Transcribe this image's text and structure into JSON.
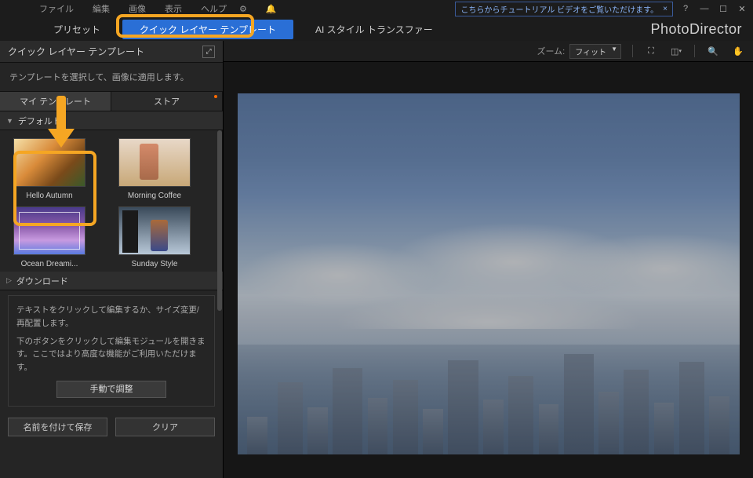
{
  "menu": {
    "file": "ファイル",
    "edit": "編集",
    "image": "画像",
    "view": "表示",
    "help": "ヘルプ"
  },
  "menubar_icons": [
    "gear-icon",
    "bell-icon"
  ],
  "tutorial_link": "こちらからチュートリアル ビデオをご覧いただけます。",
  "brand": "PhotoDirector",
  "tabs": {
    "preset": "プリセット",
    "quick_layer": "クイック レイヤー テンプレート",
    "ai_style": "AI スタイル トランスファー"
  },
  "panel": {
    "title": "クイック レイヤー テンプレート",
    "desc": "テンプレートを選択して、画像に適用します。",
    "subtabs": {
      "my": "マイ テンプレート",
      "store": "ストア"
    },
    "section_default": "デフォルト",
    "section_download": "ダウンロード",
    "templates": [
      {
        "label": "Hello Autumn",
        "thumb": "autumn"
      },
      {
        "label": "Morning Coffee",
        "thumb": "coffee"
      },
      {
        "label": "Ocean Dreami...",
        "thumb": "ocean"
      },
      {
        "label": "Sunday Style",
        "thumb": "sunday"
      }
    ],
    "help1": "テキストをクリックして編集するか、サイズ変更/再配置します。",
    "help2": "下のボタンをクリックして編集モジュールを開きます。ここではより高度な機能がご利用いただけます。",
    "manual_btn": "手動で調整",
    "save_btn": "名前を付けて保存",
    "clear_btn": "クリア"
  },
  "toolbar": {
    "zoom_label": "ズーム:",
    "zoom_value": "フィット"
  },
  "colors": {
    "highlight": "#f5a623",
    "primary": "#2a6fd6"
  }
}
